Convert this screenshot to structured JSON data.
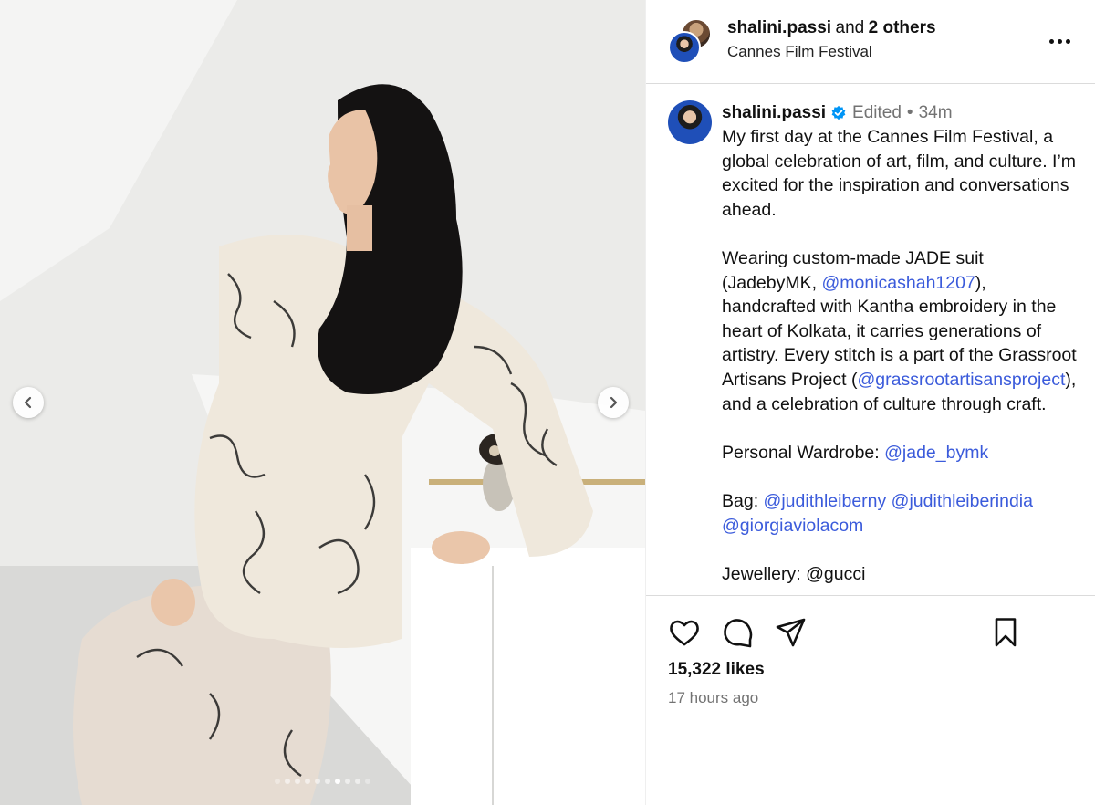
{
  "header": {
    "username": "shalini.passi",
    "and_text": "and",
    "others_text": "2 others",
    "location": "Cannes Film Festival",
    "more_icon": "more-horizontal-icon"
  },
  "caption": {
    "username": "shalini.passi",
    "verified_icon": "verified-badge-icon",
    "edited_label": "Edited",
    "separator": "•",
    "time": "34m",
    "para1": "My first day at the Cannes Film Festival, a global celebration of art, film, and culture. I’m excited for the inspiration and conversations ahead.",
    "para2_a": "Wearing custom-made JADE suit (JadebyMK, ",
    "mention_monicashah": "@monicashah1207",
    "para2_b": "), handcrafted with Kantha embroidery in the heart of Kolkata, it carries generations of artistry. Every stitch is a part of the Grassroot Artisans Project (",
    "mention_grassroot": "@grassrootartisansproject",
    "para2_c": "), and a celebration of culture through craft.",
    "wardrobe_label": "Personal Wardrobe: ",
    "mention_jade": "@jade_bymk",
    "bag_label": "Bag: ",
    "mention_judith1": "@judithleiberny",
    "mention_judith2": "@judithleiberindia",
    "mention_giorgia": "@giorgiaviolacom",
    "jewellery_partial": "Jewellery: @gucci"
  },
  "actions": {
    "like_icon": "heart-icon",
    "comment_icon": "comment-icon",
    "share_icon": "share-icon",
    "save_icon": "bookmark-icon"
  },
  "stats": {
    "likes": "15,322 likes",
    "time_ago": "17 hours ago"
  },
  "carousel": {
    "total_slides": 10,
    "active_index": 6,
    "prev_icon": "chevron-left-icon",
    "next_icon": "chevron-right-icon"
  }
}
